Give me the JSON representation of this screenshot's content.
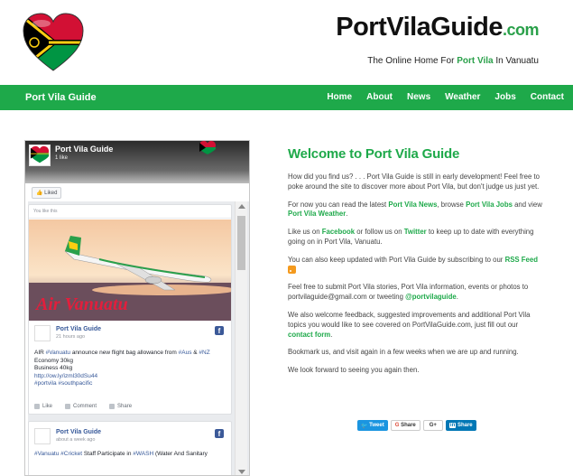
{
  "header": {
    "site_title": "PortVilaGuide",
    "site_tld": ".com",
    "tagline_prefix": "The Online Home For ",
    "tagline_highlight": "Port Vila",
    "tagline_suffix": " In Vanuatu"
  },
  "nav": {
    "brand": "Port Vila Guide",
    "items": [
      "Home",
      "About",
      "News",
      "Weather",
      "Jobs",
      "Contact"
    ]
  },
  "facebook_widget": {
    "page_name": "Port Vila Guide",
    "likes": "1 like",
    "liked_button": "Liked",
    "you_like_this": "You like this",
    "post1": {
      "author": "Port Vila Guide",
      "time": "21 hours ago",
      "image_text": "Air Vanuatu",
      "text_line1_a": "AIR ",
      "text_line1_tag1": "#Vanuatu",
      "text_line1_b": " announce new flight bag allowance from ",
      "text_line1_tag2": "#Aus",
      "text_line1_c": " & ",
      "text_line1_tag3": "#NZ",
      "text_line2": "Economy 30kg",
      "text_line3": "Business 40kg",
      "text_link": "http://ow.ly/izml30dSu44",
      "text_tags": "#portvila #southpacific",
      "actions": [
        "Like",
        "Comment",
        "Share"
      ]
    },
    "post2": {
      "author": "Port Vila Guide",
      "time": "about a week ago",
      "text_tag1": "#Vanuatu",
      "text_tag2": "#Cricket",
      "text_a": " Staff Participate in ",
      "text_tag3": "#WASH",
      "text_b": " (Water And Sanitary"
    }
  },
  "main": {
    "title": "Welcome to Port Vila Guide",
    "p1": "How did you find us? . . . Port Vila Guide is still in early development! Feel free to poke around the site to discover more about Port Vila, but don't judge us just yet.",
    "p2_a": "For now you can read the latest ",
    "p2_link1": "Port Vila News",
    "p2_b": ", browse ",
    "p2_link2": "Port Vila Jobs",
    "p2_c": " and view ",
    "p2_link3": "Port Vila Weather",
    "p2_d": ".",
    "p3_a": "Like us on ",
    "p3_link1": "Facebook",
    "p3_b": " or follow us on ",
    "p3_link2": "Twitter",
    "p3_c": " to keep up to date with everything going on in Port Vila, Vanuatu.",
    "p4_a": "You can also keep updated with Port Vila Guide by subscribing to our ",
    "p4_link": "RSS Feed",
    "p5_a": "Feel free to submit Port Vila stories, Port Vila information, events or photos to portvilaguide@gmail.com or tweeting ",
    "p5_link": "@portvilaguide",
    "p5_b": ".",
    "p6_a": "We also welcome feedback, suggested improvements and additional Port Vila topics you would like to see covered on PortVilaGuide.com, just fill out our ",
    "p6_link": "contact form",
    "p6_b": ".",
    "p7": "Bookmark us, and visit again in a few weeks when we are up and running.",
    "p8": "We look forward to seeing you again then."
  },
  "share": {
    "tweet": "Tweet",
    "google_share": "Share",
    "google_plus": "G+",
    "linkedin_share": "Share"
  },
  "colors": {
    "brand_green": "#1ea94a",
    "facebook_blue": "#365899",
    "twitter_blue": "#1b95e0",
    "linkedin_blue": "#0077b5"
  },
  "icons": [
    "vanuatu-flag-heart-icon",
    "rss-icon",
    "facebook-icon",
    "twitter-icon",
    "google-plus-icon",
    "linkedin-icon"
  ]
}
